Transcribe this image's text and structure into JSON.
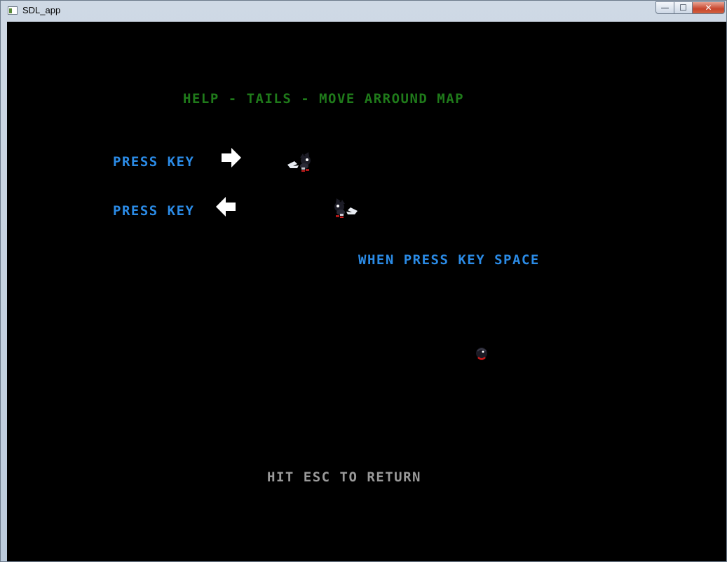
{
  "window": {
    "title": "SDL_app",
    "controls": {
      "minimize": "—",
      "maximize": "☐",
      "close": "✕"
    }
  },
  "game": {
    "heading": "HELP - TAILS - MOVE ARROUND MAP",
    "rows": [
      {
        "label": "PRESS KEY",
        "icon": "arrow-right-icon",
        "sprite": "tails-running-right"
      },
      {
        "label": "PRESS KEY",
        "icon": "arrow-left-icon",
        "sprite": "tails-running-left"
      }
    ],
    "space_text": "WHEN PRESS KEY SPACE",
    "space_sprite": "tails-spin-ball",
    "footer": "HIT ESC TO RETURN"
  },
  "colors": {
    "background": "#000000",
    "heading": "#1f7a1a",
    "instructions": "#2b8be6",
    "footer": "#9a9a9a",
    "arrow": "#ffffff"
  }
}
